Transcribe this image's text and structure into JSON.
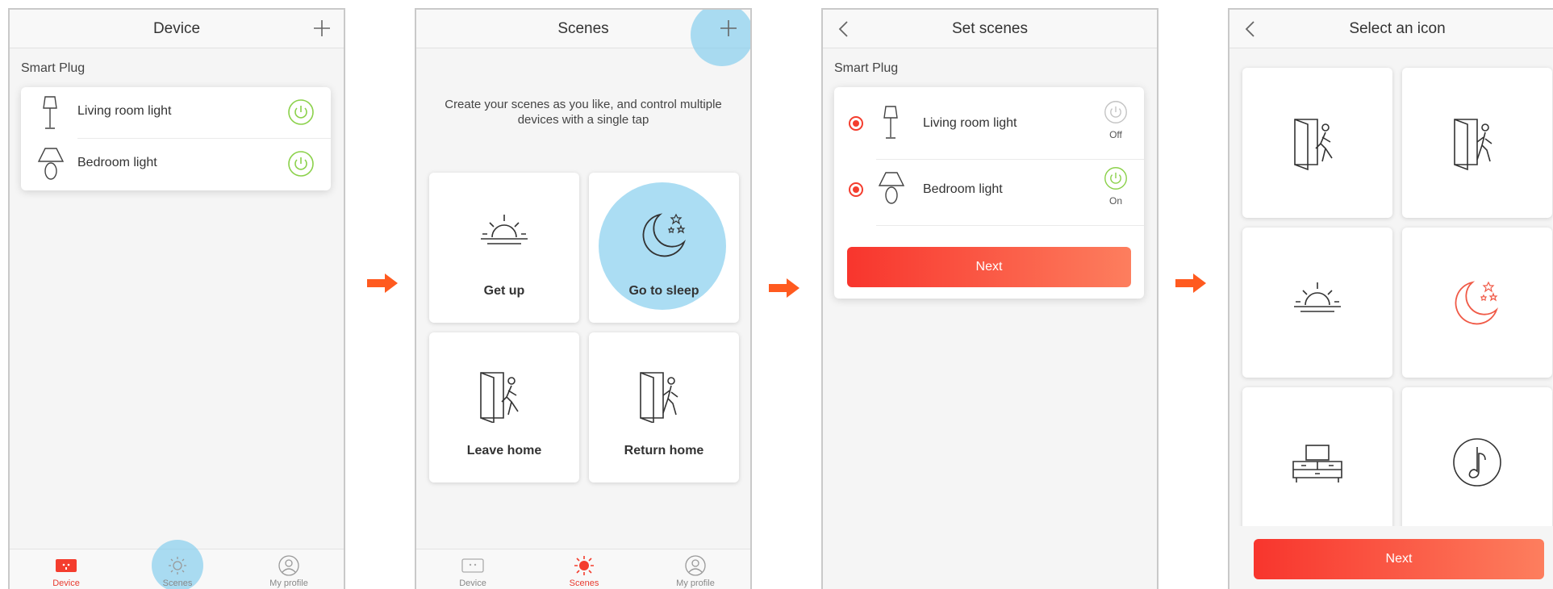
{
  "screen1": {
    "title": "Device",
    "section": "Smart Plug",
    "devices": [
      {
        "name": "Living room light",
        "icon": "floor-lamp-icon"
      },
      {
        "name": "Bedroom light",
        "icon": "table-lamp-icon"
      }
    ],
    "tabs": [
      {
        "label": "Device",
        "icon": "plug-icon",
        "active": true
      },
      {
        "label": "Scenes",
        "icon": "sun-icon",
        "active": false
      },
      {
        "label": "My profile",
        "icon": "profile-icon",
        "active": false
      }
    ]
  },
  "screen2": {
    "title": "Scenes",
    "description": "Create your scenes as you like, and control multiple devices with a single tap",
    "scenes": [
      {
        "label": "Get up",
        "icon": "sunrise-icon"
      },
      {
        "label": "Go to sleep",
        "icon": "moon-stars-icon"
      },
      {
        "label": "Leave home",
        "icon": "leave-home-icon"
      },
      {
        "label": "Return home",
        "icon": "return-home-icon"
      }
    ],
    "tabs": [
      {
        "label": "Device",
        "icon": "plug-icon",
        "active": false
      },
      {
        "label": "Scenes",
        "icon": "sun-icon",
        "active": true
      },
      {
        "label": "My profile",
        "icon": "profile-icon",
        "active": false
      }
    ]
  },
  "screen3": {
    "title": "Set scenes",
    "section": "Smart Plug",
    "devices": [
      {
        "name": "Living room light",
        "status": "Off"
      },
      {
        "name": "Bedroom light",
        "status": "On"
      }
    ],
    "next_label": "Next"
  },
  "screen4": {
    "title": "Select an icon",
    "icons": [
      "leave-home-icon",
      "return-home-icon",
      "sunrise-icon",
      "moon-stars-icon",
      "tv-cabinet-icon",
      "music-note-icon"
    ],
    "next_label": "Next"
  },
  "colors": {
    "accent": "#f43d2e",
    "power_on": "#8bd14a",
    "power_off": "#bdbdbd",
    "highlight": "#88cfee",
    "arrow": "#ff5a1f"
  }
}
